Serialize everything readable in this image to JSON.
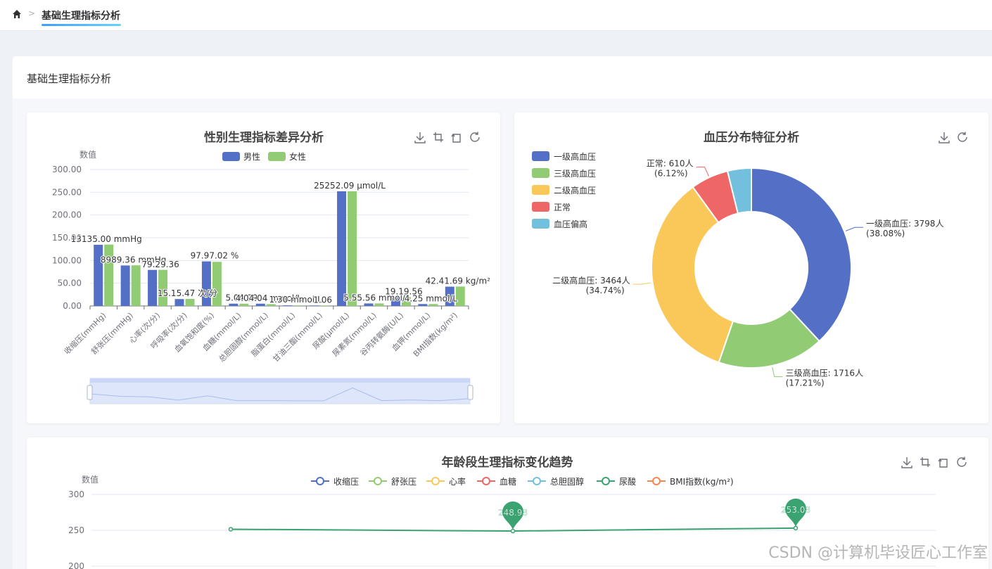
{
  "breadcrumb": {
    "home_icon": "home-icon",
    "separator": ">",
    "active_tab": "基础生理指标分析"
  },
  "page": {
    "title": "基础生理指标分析"
  },
  "toolbox_icons": [
    "download-icon",
    "crop-icon",
    "undo-icon",
    "refresh-icon"
  ],
  "watermark": "CSDN @计算机毕设匠心工作室",
  "chart_data": [
    {
      "type": "bar",
      "title": "性别生理指标差异分析",
      "ylabel": "数值",
      "ylim": [
        0,
        300
      ],
      "yticks": [
        "0.00",
        "50.00",
        "100.00",
        "150.00",
        "200.00",
        "250.00",
        "300.00"
      ],
      "categories": [
        "收缩压(mmHg)",
        "舒张压(mmHg)",
        "心率(次/分)",
        "呼吸率(次/分)",
        "血氧饱和度(%)",
        "血糖(mmol/L)",
        "总胆固醇(mmol/L)",
        "脂蛋白(mmol/L)",
        "甘油三酯(mmol/L)",
        "尿酸(μmol/L)",
        "尿素氮(mmol/L)",
        "谷丙转氨酶(U/L)",
        "血钾(mmol/L)",
        "BMI指数(kg/m²)"
      ],
      "series": [
        {
          "name": "男性",
          "color": "#5470c6",
          "values": [
            134.5,
            89.0,
            79.2,
            15.15,
            97.97,
            5.04,
            4.99,
            1.3,
            1.06,
            252.09,
            5.5,
            19.19,
            4.25,
            42.41
          ]
        },
        {
          "name": "女性",
          "color": "#91cc75",
          "values": [
            135.0,
            89.36,
            79.36,
            15.47,
            97.02,
            4.99,
            4.04,
            1.3,
            1.06,
            252.09,
            5.56,
            19.56,
            4.25,
            42.69
          ]
        }
      ],
      "data_labels": [
        {
          "text": "13135.00 mmHg",
          "cat": 0,
          "v": 134.5
        },
        {
          "text": "8989.36 mmHg",
          "cat": 1,
          "v": 89.0
        },
        {
          "text": "79.29.36",
          "cat": 2,
          "v": 79.2
        },
        {
          "text": "15.15.47 次/分",
          "cat": 3,
          "v": 15.15
        },
        {
          "text": "97.97.02 %",
          "cat": 4,
          "v": 97.97
        },
        {
          "text": "5.04.99",
          "cat": 5,
          "v": 5.04
        },
        {
          "text": "4.04.04 mmol/L",
          "cat": 6,
          "v": 4.99
        },
        {
          "text": "1.30 mmol/L",
          "cat": 7,
          "v": 1.3
        },
        {
          "text": "1.06",
          "cat": 8,
          "v": 1.06
        },
        {
          "text": "25252.09 μmol/L",
          "cat": 9,
          "v": 252.09
        },
        {
          "text": "5.55.56 mmol/L",
          "cat": 10,
          "v": 5.5
        },
        {
          "text": "19.19.56",
          "cat": 11,
          "v": 19.19
        },
        {
          "text": "4.25 mmol/L",
          "cat": 12,
          "v": 4.25
        },
        {
          "text": "42.41.69 kg/m²",
          "cat": 13,
          "v": 42.41
        }
      ],
      "grid": true,
      "legend": "top",
      "datazoom": true
    },
    {
      "type": "pie",
      "title": "血压分布特征分析",
      "legend": "left",
      "slices": [
        {
          "name": "一级高血压",
          "value": 3798,
          "label": "一级高血压: 3798人",
          "pct": "(38.08%)",
          "color": "#5470c6"
        },
        {
          "name": "三级高血压",
          "value": 1716,
          "label": "三级高血压: 1716人",
          "pct": "(17.21%)",
          "color": "#91cc75"
        },
        {
          "name": "二级高血压",
          "value": 3464,
          "label": "二级高血压: 3464人",
          "pct": "(34.74%)",
          "color": "#fac858"
        },
        {
          "name": "正常",
          "value": 610,
          "label": "正常: 610人",
          "pct": "(6.12%)",
          "color": "#ee6666"
        },
        {
          "name": "血压偏高",
          "value": 384,
          "label": "",
          "pct": "",
          "color": "#73c0de"
        }
      ]
    },
    {
      "type": "line",
      "title": "年龄段生理指标变化趋势",
      "ylabel": "数值",
      "ylim": [
        200,
        300
      ],
      "yticks": [
        "200",
        "250",
        "300"
      ],
      "legend": "top",
      "series": [
        {
          "name": "收缩压",
          "color": "#5470c6",
          "values": []
        },
        {
          "name": "舒张压",
          "color": "#91cc75",
          "values": []
        },
        {
          "name": "心率",
          "color": "#fac858",
          "values": []
        },
        {
          "name": "血糖",
          "color": "#ee6666",
          "values": []
        },
        {
          "name": "总胆固醇",
          "color": "#73c0de",
          "values": []
        },
        {
          "name": "尿酸",
          "color": "#3ba272",
          "values": [
            251.5,
            248.98,
            253.08
          ]
        },
        {
          "name": "BMI指数(kg/m²)",
          "color": "#fc8452",
          "values": []
        }
      ],
      "markpoints": [
        "248.98",
        "253.08"
      ]
    }
  ]
}
